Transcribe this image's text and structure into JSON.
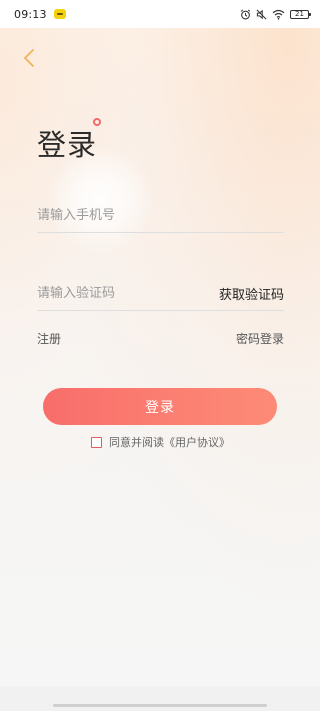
{
  "status_bar": {
    "time": "09:13",
    "battery": "21",
    "icons": [
      "app-notification-icon",
      "alarm-icon",
      "mute-icon",
      "wifi-icon",
      "battery-icon"
    ]
  },
  "header": {
    "back_icon": "chevron-left-icon",
    "title": "登录"
  },
  "form": {
    "phone_placeholder": "请输入手机号",
    "code_placeholder": "请输入验证码",
    "get_code_label": "获取验证码"
  },
  "links": {
    "register": "注册",
    "password_login": "密码登录"
  },
  "login_button": {
    "label": "登录"
  },
  "agreement": {
    "checked": false,
    "prefix": "同意并阅读",
    "link": "《用户协议》"
  },
  "colors": {
    "accent": "#f86d6a",
    "back_icon": "#f0b35a",
    "checkbox_border": "#e35c5c"
  }
}
